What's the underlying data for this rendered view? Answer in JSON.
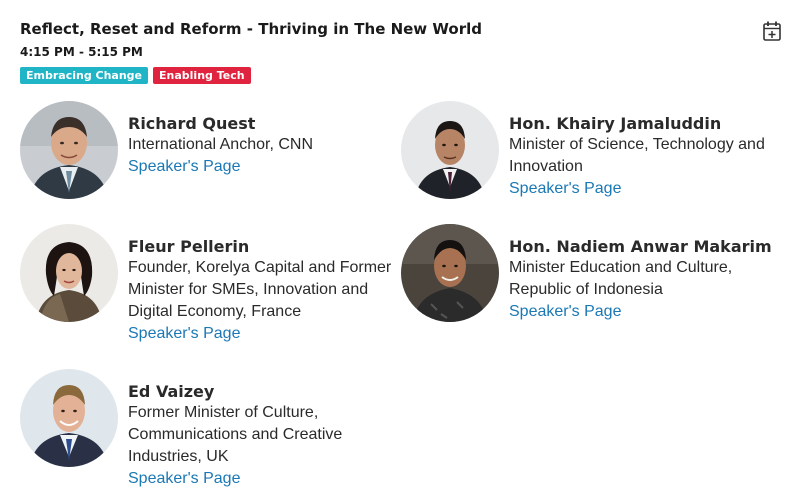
{
  "session": {
    "title": "Reflect, Reset and Reform - Thriving in The New World",
    "time": "4:15 PM - 5:15 PM",
    "tags": [
      {
        "label": "Embracing Change",
        "color": "#1fb5c7"
      },
      {
        "label": "Enabling Tech",
        "color": "#e0243f"
      }
    ],
    "calendar_icon": "calendar-add-icon"
  },
  "speakers": [
    {
      "name": "Richard Quest",
      "role_lines": [
        "International Anchor, CNN"
      ],
      "link": "Speaker's Page"
    },
    {
      "name": "Hon. Khairy Jamaluddin",
      "role_lines": [
        "Minister of Science, Technology and",
        "Innovation"
      ],
      "link": "Speaker's Page"
    },
    {
      "name": "Fleur Pellerin",
      "role_lines": [
        "Founder, Korelya Capital and Former",
        "Minister for SMEs, Innovation and",
        "Digital Economy, France"
      ],
      "link": "Speaker's Page"
    },
    {
      "name": "Hon. Nadiem Anwar Makarim",
      "role_lines": [
        "Minister Education and Culture,",
        "Republic of Indonesia"
      ],
      "link": "Speaker's Page"
    },
    {
      "name": "Ed Vaizey",
      "role_lines": [
        "Former Minister of Culture,",
        "Communications and Creative",
        "Industries, UK"
      ],
      "link": "Speaker's Page"
    }
  ],
  "colors": {
    "link": "#1a78b4",
    "text": "#2a2a2a"
  }
}
